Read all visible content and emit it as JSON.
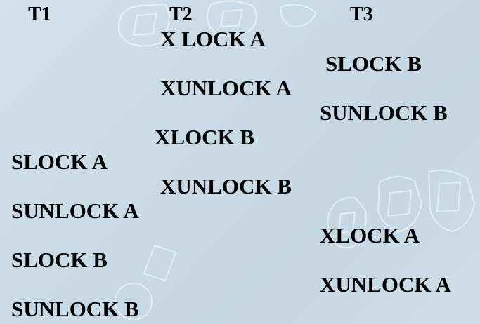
{
  "headers": {
    "t1": "T1",
    "t2": "T2",
    "t3": "T3"
  },
  "t1_ops": [
    "SLOCK A",
    "SUNLOCK A",
    "SLOCK B",
    "SUNLOCK B"
  ],
  "t2_ops": [
    "X LOCK A",
    "XUNLOCK A",
    "XLOCK B",
    "XUNLOCK B"
  ],
  "t3_ops": [
    "SLOCK B",
    "SUNLOCK B",
    "XLOCK A",
    "XUNLOCK A"
  ],
  "colors": {
    "background": "#c9dbe6",
    "text": "#000000",
    "watermark": "#ffffff"
  }
}
